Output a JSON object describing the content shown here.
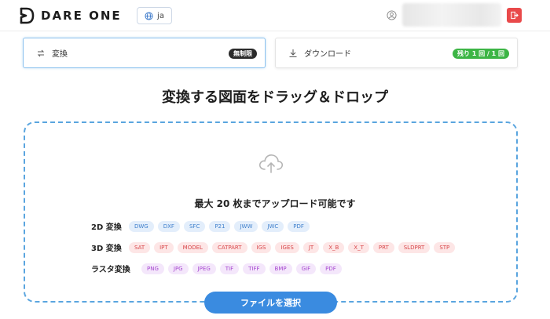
{
  "header": {
    "logo_text": "DARE ONE",
    "language": "ja"
  },
  "tabs": [
    {
      "label": "変換",
      "badge": "無制限",
      "active": true
    },
    {
      "label": "ダウンロード",
      "badge": "残り 1 回 / 1 回",
      "active": false
    }
  ],
  "main": {
    "heading": "変換する図面をドラッグ＆ドロップ",
    "limit_text": "最大 20 枚までアップロード可能です",
    "formats": {
      "d2_label": "2D 変換",
      "d2": [
        "DWG",
        "DXF",
        "SFC",
        "P21",
        "JWW",
        "JWC",
        "PDF"
      ],
      "d3_label": "3D 変換",
      "d3": [
        "SAT",
        "IPT",
        "MODEL",
        "CATPART",
        "IGS",
        "IGES",
        "JT",
        "X_B",
        "X_T",
        "PRT",
        "SLDPRT",
        "STP"
      ],
      "raster_label": "ラスタ変換",
      "raster": [
        "PNG",
        "JPG",
        "JPEG",
        "TIF",
        "TIFF",
        "BMP",
        "GIF",
        "PDF"
      ]
    },
    "select_button": "ファイルを選択"
  },
  "colors": {
    "accent": "#3a8be0",
    "logout": "#e9494a",
    "badge_green": "#3cb545",
    "dropzone_border": "#5aa5df"
  },
  "icons": [
    "dare-one-logo-icon",
    "globe-icon",
    "user-icon",
    "logout-icon",
    "convert-icon",
    "download-icon",
    "cloud-upload-icon"
  ]
}
